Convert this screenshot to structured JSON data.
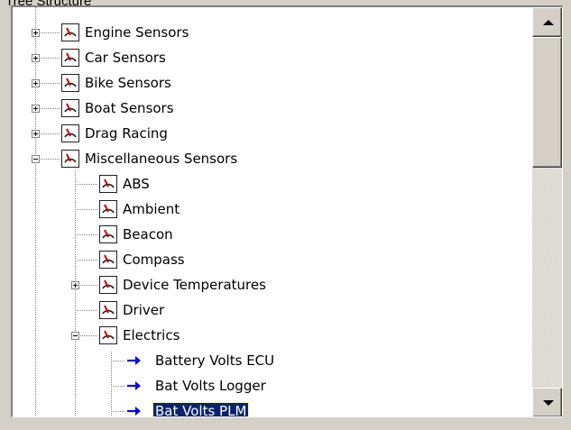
{
  "window": {
    "clipped_label": "Tree Structure"
  },
  "tree": {
    "top_level": [
      {
        "label": "Engine Sensors",
        "expanded": false
      },
      {
        "label": "Car Sensors",
        "expanded": false
      },
      {
        "label": "Bike Sensors",
        "expanded": false
      },
      {
        "label": "Boat Sensors",
        "expanded": false
      },
      {
        "label": "Drag Racing",
        "expanded": false
      },
      {
        "label": "Miscellaneous Sensors",
        "expanded": true
      }
    ],
    "misc_children": [
      {
        "label": "ABS"
      },
      {
        "label": "Ambient"
      },
      {
        "label": "Beacon"
      },
      {
        "label": "Compass"
      },
      {
        "label": "Device Temperatures",
        "expandable": true
      },
      {
        "label": "Driver"
      },
      {
        "label": "Electrics",
        "expanded": true
      }
    ],
    "electrics_children": [
      {
        "label": "Battery Volts ECU"
      },
      {
        "label": "Bat Volts Logger"
      },
      {
        "label": "Bat Volts PLM",
        "selected": true
      }
    ]
  },
  "colors": {
    "selection": "#0a246a",
    "arrow": "#0000ff",
    "gauge_frame": "#202020",
    "gauge_needle": "#d00000"
  },
  "icons": {
    "gauge": "gauge-icon",
    "arrow": "arrow-right-icon",
    "scroll_up": "triangle-up-icon",
    "scroll_down": "triangle-down-icon"
  }
}
